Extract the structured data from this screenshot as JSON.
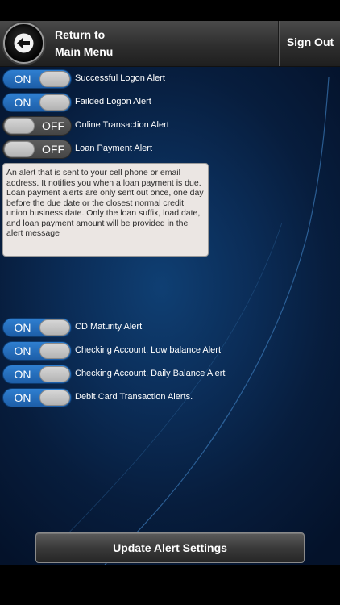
{
  "header": {
    "return_line1": "Return to",
    "return_line2": "Main Menu",
    "sign_out": "Sign Out"
  },
  "alerts_top": [
    {
      "label": "Successful Logon Alert",
      "state": "ON"
    },
    {
      "label": "Failded Logon Alert",
      "state": "ON"
    },
    {
      "label": "Online Transaction Alert",
      "state": "OFF"
    },
    {
      "label": "Loan Payment Alert",
      "state": "OFF"
    }
  ],
  "info_text": "An alert that is sent to your cell phone or email address. It notifies you when a loan payment is due. Loan payment alerts are only sent out once, one day before the due date or the closest normal credit union business date. Only the loan suffix, load date, and loan payment amount will be provided in the alert message",
  "alerts_bottom": [
    {
      "label": "CD Maturity Alert",
      "state": "ON"
    },
    {
      "label": "Checking Account, Low balance Alert",
      "state": "ON"
    },
    {
      "label": "Checking Account, Daily Balance Alert",
      "state": "ON"
    },
    {
      "label": "Debit Card Transaction Alerts.",
      "state": "ON"
    }
  ],
  "update_button": "Update Alert Settings",
  "colors": {
    "toggle_on": "#2a74c4",
    "toggle_off": "#555555",
    "header": "#333333",
    "background": "#0b2d58"
  },
  "icons": {
    "back": "back-arrow-icon"
  }
}
